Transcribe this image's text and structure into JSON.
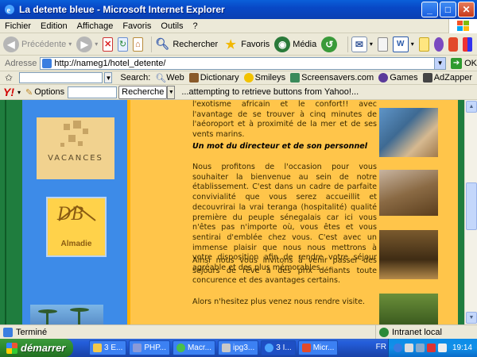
{
  "window": {
    "title": "La detente bleue - Microsoft Internet Explorer"
  },
  "menubar": {
    "items": [
      "Fichier",
      "Edition",
      "Affichage",
      "Favoris",
      "Outils",
      "?"
    ]
  },
  "toolbar": {
    "back_label": "Précédente",
    "search_label": "Rechercher",
    "favorites_label": "Favoris",
    "media_label": "Média"
  },
  "address": {
    "label": "Adresse",
    "url": "http://nameg1/hotel_detente/",
    "go_label": "OK"
  },
  "searchbar": {
    "search_label": "Search:",
    "web": "Web",
    "dictionary": "Dictionary",
    "smileys": "Smileys",
    "screensavers": "Screensavers.com",
    "games": "Games",
    "adzapper": "AdZapper"
  },
  "yahoobar": {
    "logo": "Y!",
    "options": "Options",
    "search_button": "Recherche",
    "message": "...attempting to retrieve buttons from Yahoo!..."
  },
  "page": {
    "vacances_logo_text": "VACANCES",
    "almadie_logo_mark": "DB",
    "almadie_logo_name": "Almadie",
    "para1": "l'exotisme africain et le confort!! avec l'avantage de se trouver à cinq minutes de l'aéoroport et à proximité de la mer et de ses vents marins.",
    "heading": "Un mot du directeur et de son personnel",
    "para2": "Nous profitons de l'occasion pour vous souhaiter la bienvenue au sein de notre établissement. C'est dans un cadre de parfaite convivialité que vous serez accueillit et decouvrirai la vrai teranga (hospitalité) qualité première du peuple sénegalais car ici vous n'êtes pas n'importe où, vous êtes et vous sentirai d'emblée chez vous. C'est avec un immense plaisir que nous nous mettrons à votre disposition afin de rendre votre séjour agréable et des plus mémorables.",
    "para3": "Ainsi nous vous invitons à venir passer des sejours de rêve à des prix défiants toute concurence et des avantages certains.",
    "para4": "Alors n'hesitez plus venez nous rendre visite."
  },
  "statusbar": {
    "status": "Terminé",
    "zone": "Intranet local"
  },
  "taskbar": {
    "start": "démarrer",
    "tasks": [
      "3 E...",
      "PHP...",
      "Macr...",
      "ipg3...",
      "3 I...",
      "Micr..."
    ],
    "lang": "FR",
    "clock": "19:14"
  }
}
